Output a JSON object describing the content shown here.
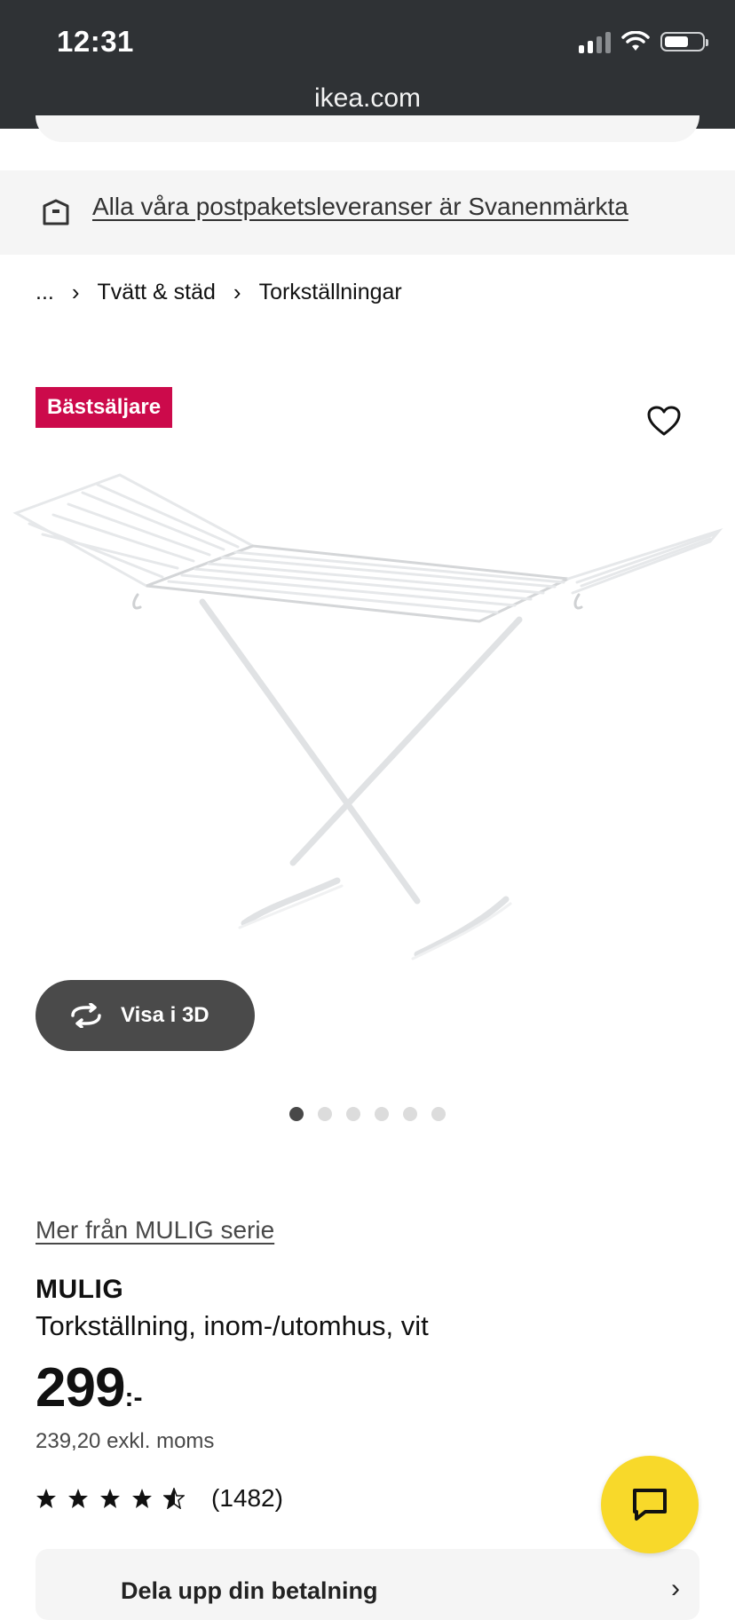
{
  "status_bar": {
    "time": "12:31"
  },
  "browser": {
    "url": "ikea.com"
  },
  "banner": {
    "text": "Alla våra postpaketsleveranser är Svanenmärkta",
    "icon": "box-icon"
  },
  "breadcrumb": {
    "ellipsis": "...",
    "items": [
      "Tvätt & städ",
      "Torkställningar"
    ]
  },
  "product": {
    "badge": "Bästsäljare",
    "view_3d_label": "Visa i 3D",
    "gallery": {
      "total_images": 6,
      "active_index": 0
    },
    "series_link": "Mer från MULIG serie",
    "name": "MULIG",
    "description": "Torkställning, inom-/utomhus, vit",
    "price": "299",
    "price_suffix": ":-",
    "price_excl_vat": "239,20 exkl. moms",
    "rating": {
      "stars": 4.5,
      "max": 5,
      "count": "(1482)"
    },
    "share_label": "Dela upp din betalning"
  },
  "colors": {
    "topbar": "#2f3235",
    "badge": "#cc0a4b",
    "chat_button": "#f8d92a",
    "view3d_button": "#4a4a4a"
  },
  "icons": {
    "heart": "heart-icon",
    "chat": "chat-icon",
    "rotate": "rotate-3d-icon",
    "wifi": "wifi-icon",
    "battery": "battery-icon",
    "signal": "signal-icon"
  }
}
